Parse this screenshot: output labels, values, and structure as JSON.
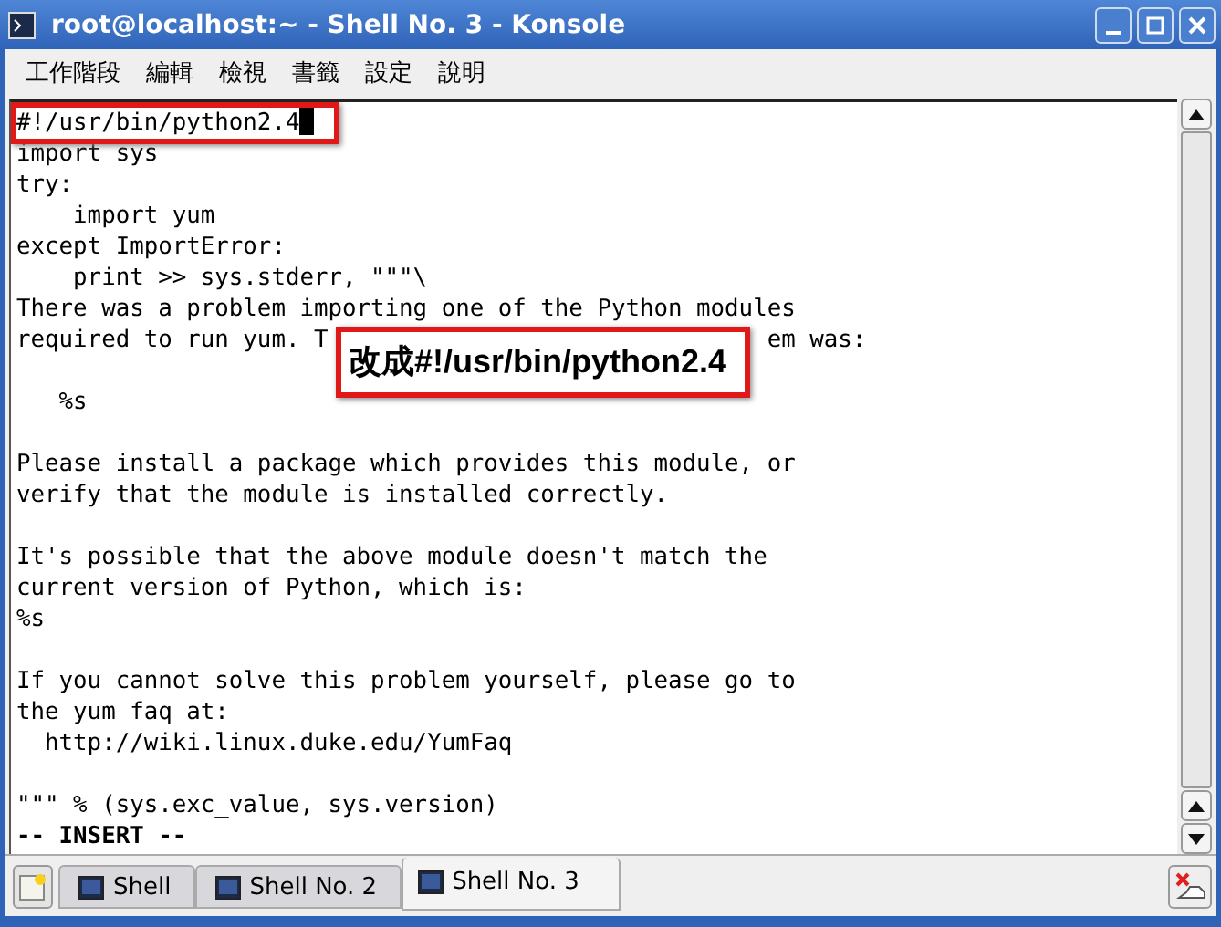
{
  "window": {
    "title": "root@localhost:~ - Shell No. 3 - Konsole"
  },
  "menu": [
    "工作階段",
    "編輯",
    "檢視",
    "書籤",
    "設定",
    "說明"
  ],
  "terminal": {
    "lines": [
      {
        "kind": "text",
        "text": "#!/usr/bin/python2.4",
        "cursor": true,
        "highlighted": true
      },
      {
        "kind": "text",
        "text": "import sys",
        "cursor": false
      },
      {
        "kind": "text",
        "text": "try:",
        "cursor": false
      },
      {
        "kind": "text",
        "text": "    import yum",
        "cursor": false
      },
      {
        "kind": "text",
        "text": "except ImportError:",
        "cursor": false
      },
      {
        "kind": "text",
        "text": "    print >> sys.stderr, \"\"\"\\",
        "cursor": false
      },
      {
        "kind": "text",
        "text": "There was a problem importing one of the Python modules",
        "cursor": false
      },
      {
        "kind": "split",
        "segments": [
          "required to run yum. T",
          "em was:"
        ]
      },
      {
        "kind": "blank"
      },
      {
        "kind": "text",
        "text": "   %s",
        "cursor": false
      },
      {
        "kind": "blank"
      },
      {
        "kind": "text",
        "text": "Please install a package which provides this module, or",
        "cursor": false
      },
      {
        "kind": "text",
        "text": "verify that the module is installed correctly.",
        "cursor": false
      },
      {
        "kind": "blank"
      },
      {
        "kind": "text",
        "text": "It's possible that the above module doesn't match the",
        "cursor": false
      },
      {
        "kind": "text",
        "text": "current version of Python, which is:",
        "cursor": false
      },
      {
        "kind": "text",
        "text": "%s",
        "cursor": false
      },
      {
        "kind": "blank"
      },
      {
        "kind": "text",
        "text": "If you cannot solve this problem yourself, please go to",
        "cursor": false
      },
      {
        "kind": "text",
        "text": "the yum faq at:",
        "cursor": false
      },
      {
        "kind": "text",
        "text": "  http://wiki.linux.duke.edu/YumFaq",
        "cursor": false
      },
      {
        "kind": "blank"
      },
      {
        "kind": "text",
        "text": "\"\"\" % (sys.exc_value, sys.version)",
        "cursor": false
      },
      {
        "kind": "status",
        "text": "-- INSERT --"
      }
    ]
  },
  "callout": {
    "text": "改成#!/usr/bin/python2.4"
  },
  "tabs": [
    {
      "label": "Shell",
      "selected": false
    },
    {
      "label": "Shell No. 2",
      "selected": false
    },
    {
      "label": "Shell No. 3",
      "selected": true
    }
  ]
}
